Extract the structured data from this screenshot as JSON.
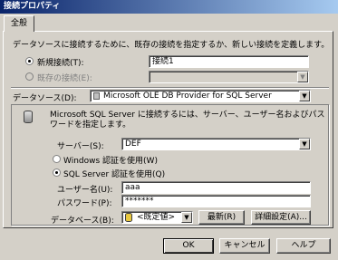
{
  "window": {
    "title": "接続プロパティ"
  },
  "tab": {
    "label": "全般"
  },
  "intro": "データソースに接続するために、既存の接続を指定するか、新しい接続を定義します。",
  "new_connection": {
    "label": "新規接続(T):",
    "value": "接続1"
  },
  "existing_connection": {
    "label": "既存の接続(E):",
    "value": ""
  },
  "data_source": {
    "label": "データソース(D):",
    "value": "Microsoft OLE DB Provider for SQL Server"
  },
  "group": {
    "description": "Microsoft SQL Server に接続するには、サーバー、ユーザー名およびパスワードを指定します。",
    "server": {
      "label": "サーバー(S):",
      "value": "DEF"
    },
    "windows_auth": "Windows 認証を使用(W)",
    "sql_auth": "SQL Server 認証を使用(Q)",
    "username": {
      "label": "ユーザー名(U):",
      "value": "aaa"
    },
    "password": {
      "label": "パスワード(P):",
      "value": "*******"
    },
    "database": {
      "label": "データベース(B):",
      "value": "<既定値>"
    },
    "refresh_button": "最新(R)",
    "advanced_button": "詳細設定(A)..."
  },
  "buttons": {
    "ok": "OK",
    "cancel": "キャンセル",
    "help": "ヘルプ"
  }
}
